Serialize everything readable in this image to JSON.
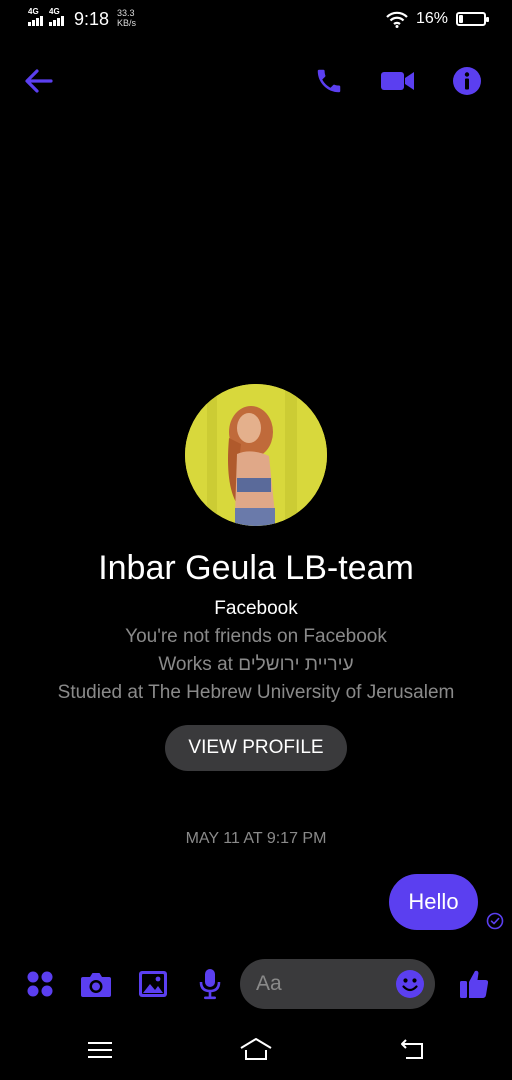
{
  "status_bar": {
    "network_1": "4G",
    "network_2": "4G",
    "time": "9:18",
    "speed_value": "33.3",
    "speed_unit": "KB/s",
    "battery_percent": "16%",
    "battery_level": 0.16
  },
  "header": {
    "icons": [
      "back-arrow-icon",
      "phone-icon",
      "video-camera-icon",
      "info-icon"
    ]
  },
  "profile": {
    "name": "Inbar Geula LB-team",
    "platform": "Facebook",
    "friend_status": "You're not friends on Facebook",
    "works_at": "Works at עיריית ירושלים",
    "studied_at": "Studied at The Hebrew University of Jerusalem",
    "view_profile_label": "VIEW PROFILE"
  },
  "conversation": {
    "timestamp": "MAY 11 AT 9:17 PM",
    "messages": [
      {
        "text": "Hello",
        "sender": "me",
        "status": "sent"
      }
    ]
  },
  "composer": {
    "placeholder": "Aa",
    "icons": [
      "apps-icon",
      "camera-icon",
      "gallery-icon",
      "microphone-icon",
      "emoji-icon",
      "thumbs-up-icon"
    ]
  },
  "colors": {
    "accent": "#5b3ff0",
    "background": "#000000",
    "secondary_text": "#8a8a8a",
    "field_background": "#3a3a3c"
  }
}
